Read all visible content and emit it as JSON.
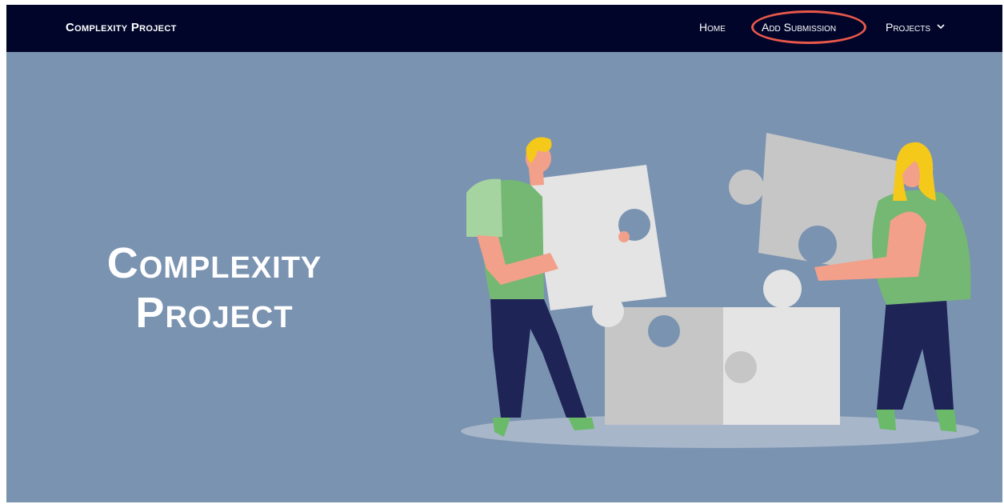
{
  "navbar": {
    "brand": "Complexity Project",
    "links": [
      {
        "label": "Home"
      },
      {
        "label": "Add Submission",
        "highlighted": true
      },
      {
        "label": "Projects",
        "icon": "chevron-down-icon"
      }
    ],
    "highlight_color": "#e9584a",
    "background": "#01052a"
  },
  "hero": {
    "title_line1": "Complexity",
    "title_line2": "Project",
    "background": "#7a93b1",
    "illustration": "two-people-assembling-puzzle-pieces"
  }
}
